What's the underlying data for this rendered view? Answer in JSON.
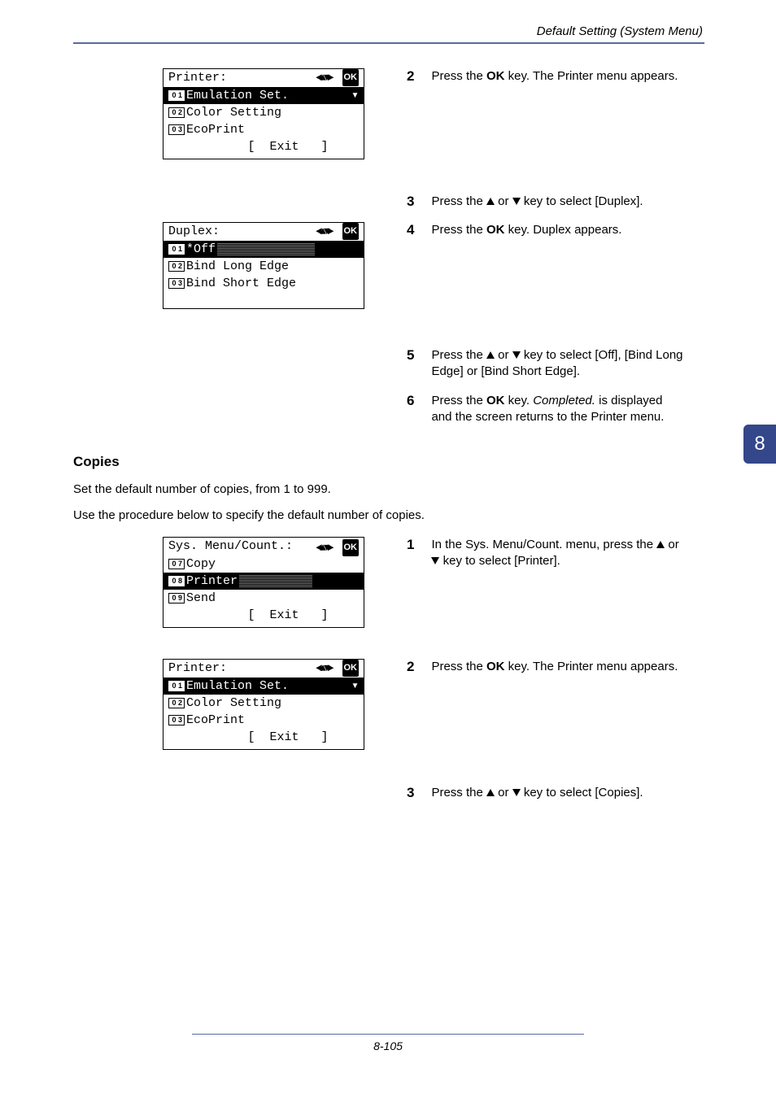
{
  "header": {
    "title": "Default Setting (System Menu)"
  },
  "pagetab": "8",
  "footer": {
    "page": "8-105"
  },
  "lcd_printer": {
    "title": "Printer:",
    "ok": "OK",
    "rows": [
      {
        "num": "0 1",
        "label": "Emulation Set.",
        "selected": true
      },
      {
        "num": "0 2",
        "label": "Color Setting",
        "selected": false
      },
      {
        "num": "0 3",
        "label": "EcoPrint",
        "selected": false
      }
    ],
    "softkey": "[  Exit   ]"
  },
  "lcd_duplex": {
    "title": "Duplex:",
    "ok": "OK",
    "rows": [
      {
        "num": "0 1",
        "label": "*Off",
        "selected": true
      },
      {
        "num": "0 2",
        "label": "Bind Long Edge",
        "selected": false
      },
      {
        "num": "0 3",
        "label": "Bind Short Edge",
        "selected": false
      }
    ]
  },
  "lcd_sysmenu": {
    "title": "Sys. Menu/Count.:",
    "ok": "OK",
    "rows": [
      {
        "num": "0 7",
        "label": "Copy",
        "selected": false
      },
      {
        "num": "0 8",
        "label": "Printer",
        "selected": true
      },
      {
        "num": "0 9",
        "label": "Send",
        "selected": false
      }
    ],
    "softkey": "[  Exit   ]"
  },
  "lcd_printer2": {
    "title": "Printer:",
    "ok": "OK",
    "rows": [
      {
        "num": "0 1",
        "label": "Emulation Set.",
        "selected": true
      },
      {
        "num": "0 2",
        "label": "Color Setting",
        "selected": false
      },
      {
        "num": "0 3",
        "label": "EcoPrint",
        "selected": false
      }
    ],
    "softkey": "[  Exit   ]"
  },
  "steps_top": {
    "s2": {
      "num": "2",
      "pre": "Press the ",
      "b": "OK",
      "post": " key. The Printer menu appears."
    },
    "s3": {
      "num": "3",
      "pre": "Press the ",
      "post": " key to select [Duplex].",
      "or": " or "
    },
    "s4": {
      "num": "4",
      "pre": "Press the ",
      "b": "OK",
      "post": " key. Duplex appears."
    },
    "s5": {
      "num": "5",
      "pre": "Press the ",
      "or": " or ",
      "post": " key to select [Off], [Bind Long Edge] or [Bind Short Edge]."
    },
    "s6": {
      "num": "6",
      "pre": "Press the ",
      "b": "OK",
      "mid": " key. ",
      "i": "Completed.",
      "post": " is displayed and the screen returns to the Printer menu."
    }
  },
  "copies": {
    "heading": "Copies",
    "p1": "Set the default number of copies, from 1 to 999.",
    "p2": "Use the procedure below to specify the default number of copies."
  },
  "steps_copies": {
    "s1": {
      "num": "1",
      "pre": "In the Sys. Menu/Count. menu, press the ",
      "or": " or ",
      "post": " key to select [Printer]."
    },
    "s2": {
      "num": "2",
      "pre": "Press the ",
      "b": "OK",
      "post": " key. The Printer menu appears."
    },
    "s3": {
      "num": "3",
      "pre": "Press the ",
      "or": " or ",
      "post": " key to select [Copies]."
    }
  }
}
